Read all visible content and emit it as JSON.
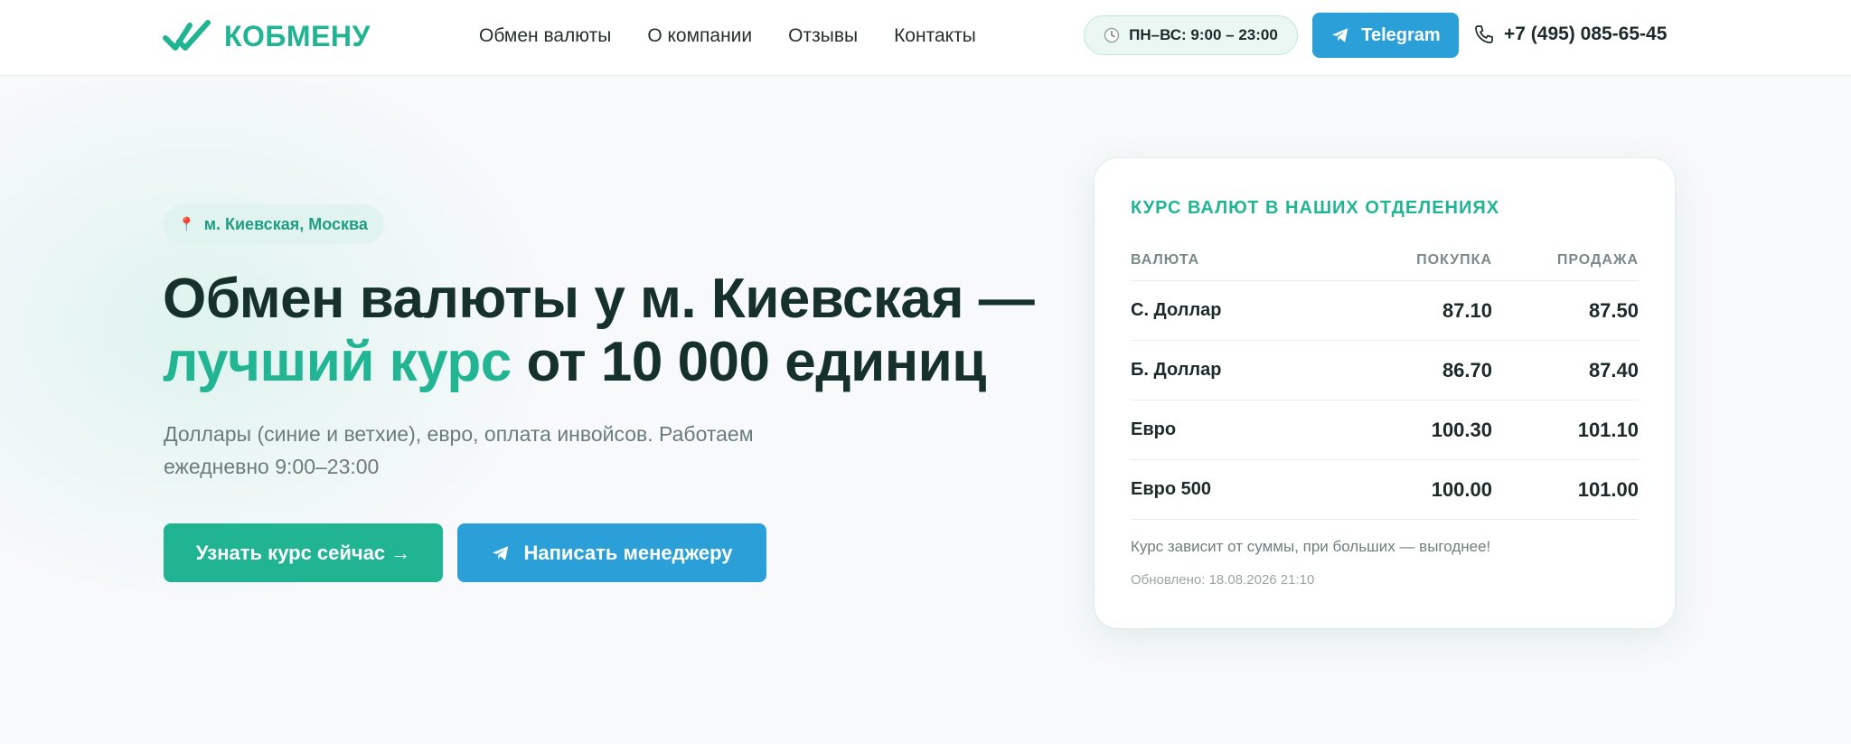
{
  "header": {
    "logo_text": "КОБМЕНУ",
    "nav": [
      "Обмен валюты",
      "О компании",
      "Отзывы",
      "Контакты"
    ],
    "hours": "ПН–ВС: 9:00 – 23:00",
    "telegram_label": "Telegram",
    "phone": "+7 (495) 085-65-45"
  },
  "hero": {
    "location": "м. Киевская, Москва",
    "headline_line1": "Обмен валюты у м. Киевская —",
    "headline_accent": "лучший курс",
    "headline_rest": " от 10 000 единиц",
    "subtitle": "Доллары (синие и ветхие), евро, оплата инвойсов. Работаем ежедневно 9:00–23:00",
    "cta_primary": "Узнать курс сейчас →",
    "cta_secondary": "Написать менеджеру"
  },
  "rates_card": {
    "title": "КУРС ВАЛЮТ В НАШИХ ОТДЕЛЕНИЯХ",
    "columns": [
      "ВАЛЮТА",
      "ПОКУПКА",
      "ПРОДАЖА"
    ],
    "rows": [
      {
        "name": "С. Доллар",
        "buy": "87.10",
        "sell": "87.50"
      },
      {
        "name": "Б. Доллар",
        "buy": "86.70",
        "sell": "87.40"
      },
      {
        "name": "Евро",
        "buy": "100.30",
        "sell": "101.10"
      },
      {
        "name": "Евро 500",
        "buy": "100.00",
        "sell": "101.00"
      }
    ],
    "note": "Курс зависит от суммы, при больших — выгоднее!",
    "updated": "Обновлено: 18.08.2026 21:10"
  },
  "colors": {
    "brand_green": "#20b493",
    "telegram_blue": "#2a9fd8",
    "dark_text": "#16302b"
  }
}
